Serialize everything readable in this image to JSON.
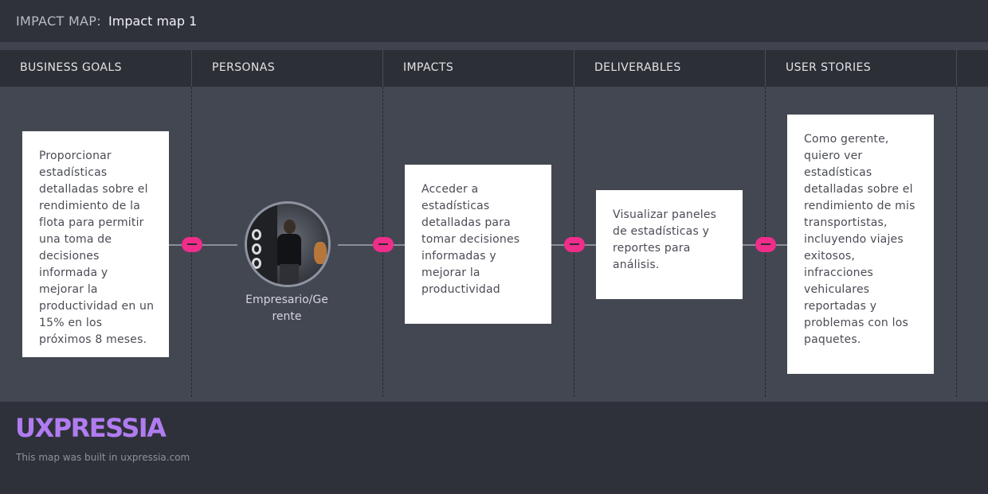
{
  "header": {
    "prefix": "IMPACT MAP:",
    "map_name": "Impact map 1"
  },
  "columns": [
    {
      "label": "BUSINESS GOALS"
    },
    {
      "label": "PERSONAS"
    },
    {
      "label": "IMPACTS"
    },
    {
      "label": "DELIVERABLES"
    },
    {
      "label": "USER STORIES"
    }
  ],
  "cards": {
    "business_goal": "Proporcionar estadísticas detalladas sobre el rendimiento de la flota para permitir una toma de decisiones informada y mejorar la productividad en un 15% en los próximos 8 meses.",
    "persona": {
      "name": "Empresario/Gerente",
      "name_line1": "Empresario/Ge",
      "name_line2": "rente"
    },
    "impact": "Acceder a estadísticas detalladas para tomar decisiones informadas y mejorar la productividad",
    "deliverable": "Visualizar paneles de estadísticas y reportes para análisis.",
    "user_story": "Como gerente, quiero ver estadísticas detalladas sobre el rendimiento de mis transportistas, incluyendo viajes exitosos, infracciones vehiculares reportadas y problemas con los paquetes."
  },
  "footer": {
    "logo": "UXPRESSIA",
    "built_with": "This map was built in uxpressia.com"
  },
  "colors": {
    "accent_toggle": "#f02d8a",
    "logo": "#b07cf0",
    "board": "#434751",
    "card": "#ffffff"
  },
  "icons": {
    "collapse": "collapse-toggle-icon",
    "avatar": "persona-avatar"
  }
}
